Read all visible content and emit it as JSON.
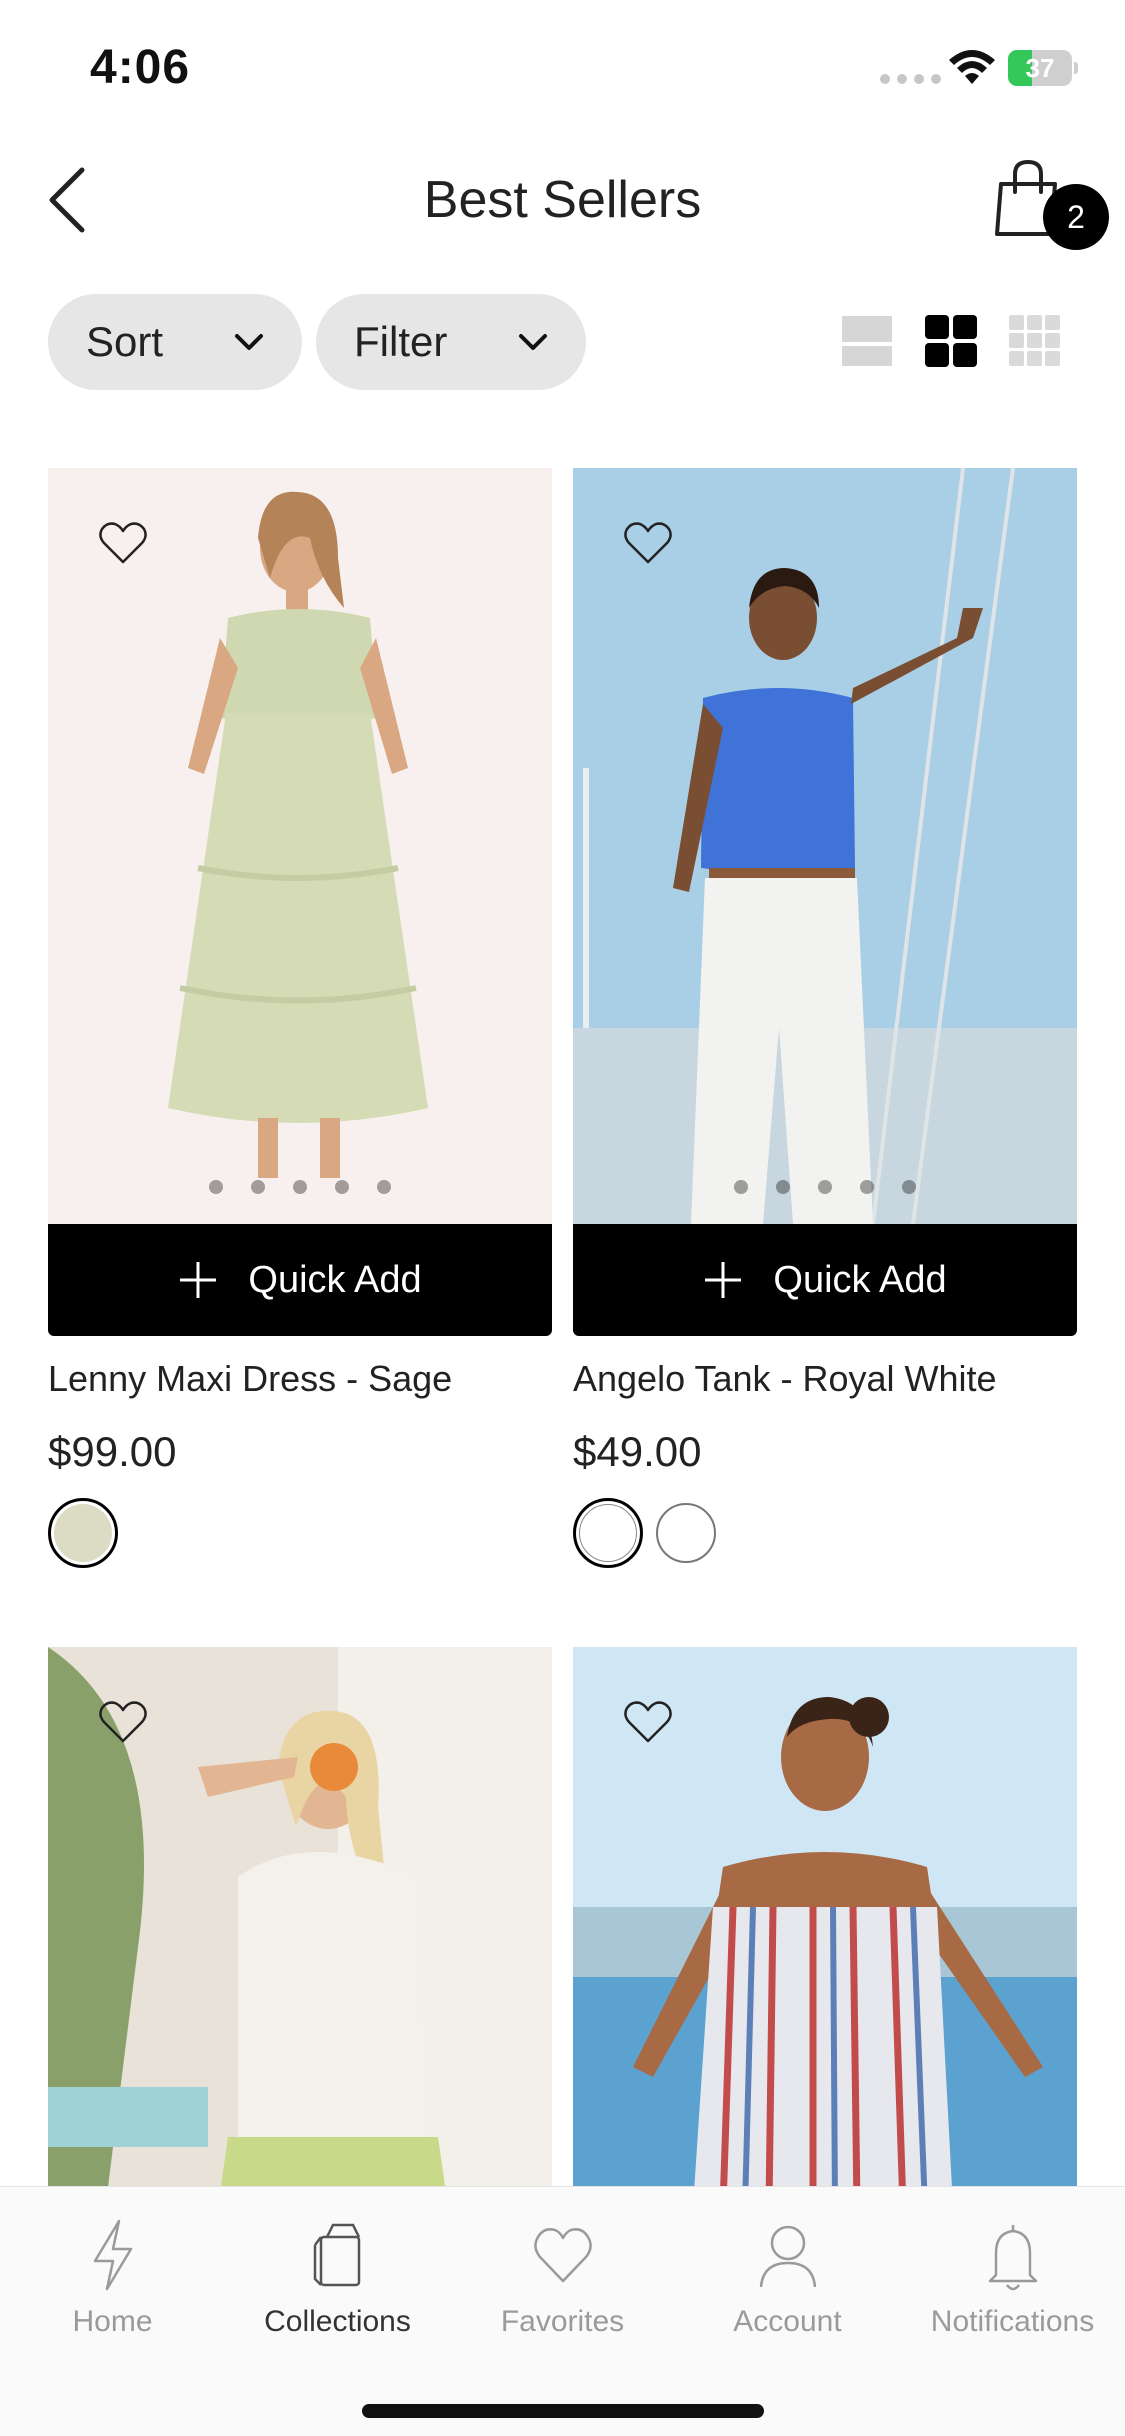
{
  "status_bar": {
    "time": "4:06",
    "battery_label": "37",
    "battery_level": 0.37
  },
  "header": {
    "title": "Best Sellers",
    "cart_count": "2"
  },
  "toolbar": {
    "sort_label": "Sort",
    "filter_label": "Filter",
    "view_modes": [
      "single-view-icon",
      "grid-2-view-icon",
      "grid-3-view-icon"
    ],
    "active_view": "grid-2-view-icon"
  },
  "products": [
    {
      "name": "Lenny Maxi Dress - Sage",
      "price": "$99.00",
      "quick_add": "Quick Add",
      "swatches": [
        "#dcdcc4"
      ],
      "selected_swatch": 0
    },
    {
      "name": "Angelo Tank - Royal White",
      "price": "$49.00",
      "quick_add": "Quick Add",
      "swatches": [
        "#ffffff",
        "#ffffff"
      ],
      "selected_swatch": 0
    },
    {
      "name": "",
      "price": ""
    },
    {
      "name": "",
      "price": ""
    }
  ],
  "tab_bar": {
    "items": [
      {
        "label": "Home",
        "icon": "lightning-icon"
      },
      {
        "label": "Collections",
        "icon": "collections-icon"
      },
      {
        "label": "Favorites",
        "icon": "heart-icon"
      },
      {
        "label": "Account",
        "icon": "person-icon"
      },
      {
        "label": "Notifications",
        "icon": "bell-icon"
      }
    ],
    "active_index": 1
  },
  "colors": {
    "accent": "#000000",
    "pill_bg": "#e6e6e6",
    "tab_inactive": "#9a9a9a",
    "battery_green": "#34c759"
  }
}
